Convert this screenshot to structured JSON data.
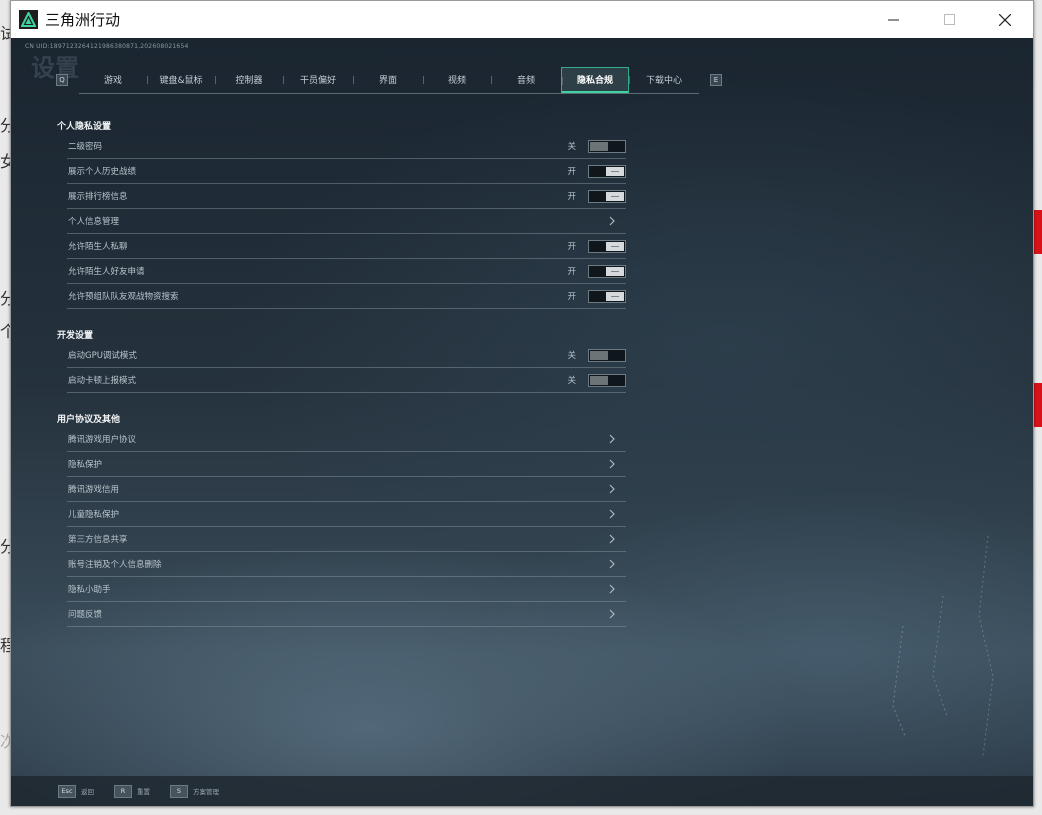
{
  "window": {
    "title": "三角洲行动",
    "controls": [
      "minimize",
      "maximize",
      "close"
    ]
  },
  "build_id": "CN UID:1897123264121986380871,202608021654",
  "ghost_title": "设置",
  "tabbar": {
    "prev_key": "Q",
    "next_key": "E",
    "tabs": [
      {
        "label": "游戏",
        "active": false
      },
      {
        "label": "键盘&鼠标",
        "active": false
      },
      {
        "label": "控制器",
        "active": false
      },
      {
        "label": "干员偏好",
        "active": false
      },
      {
        "label": "界面",
        "active": false
      },
      {
        "label": "视频",
        "active": false
      },
      {
        "label": "音频",
        "active": false
      },
      {
        "label": "隐私合规",
        "active": true
      },
      {
        "label": "下载中心",
        "active": false
      }
    ]
  },
  "privacy": {
    "title": "个人隐私设置",
    "rows": [
      {
        "label": "二级密码",
        "state": "关",
        "type": "toggle",
        "on": false
      },
      {
        "label": "展示个人历史战绩",
        "state": "开",
        "type": "toggle",
        "on": true
      },
      {
        "label": "展示排行榜信息",
        "state": "开",
        "type": "toggle",
        "on": true
      },
      {
        "label": "个人信息管理",
        "state": "",
        "type": "link"
      },
      {
        "label": "允许陌生人私聊",
        "state": "开",
        "type": "toggle",
        "on": true
      },
      {
        "label": "允许陌生人好友申请",
        "state": "开",
        "type": "toggle",
        "on": true
      },
      {
        "label": "允许预组队队友观战物资搜索",
        "state": "开",
        "type": "toggle",
        "on": true
      }
    ]
  },
  "dev": {
    "title": "开发设置",
    "rows": [
      {
        "label": "启动GPU调试模式",
        "state": "关",
        "type": "toggle",
        "on": false
      },
      {
        "label": "启动卡顿上报模式",
        "state": "关",
        "type": "toggle",
        "on": false
      }
    ]
  },
  "agreements": {
    "title": "用户协议及其他",
    "rows": [
      {
        "label": "腾讯游戏用户协议",
        "type": "link"
      },
      {
        "label": "隐私保护",
        "type": "link"
      },
      {
        "label": "腾讯游戏信用",
        "type": "link"
      },
      {
        "label": "儿童隐私保护",
        "type": "link"
      },
      {
        "label": "第三方信息共享",
        "type": "link"
      },
      {
        "label": "账号注销及个人信息删除",
        "type": "link"
      },
      {
        "label": "隐私小助手",
        "type": "link"
      },
      {
        "label": "问题反馈",
        "type": "link"
      }
    ]
  },
  "bottom_hints": [
    {
      "key": "Esc",
      "label": "返回"
    },
    {
      "key": "R",
      "label": "重置"
    },
    {
      "key": "S",
      "label": "方案管理"
    }
  ],
  "background_app": {
    "glyphs": [
      "试",
      "分",
      "女",
      "分",
      "个",
      "分",
      "程",
      "次"
    ]
  },
  "colors": {
    "accent": "#3fd3a1",
    "background": "#1b2631",
    "text": "#b9c4cc"
  }
}
